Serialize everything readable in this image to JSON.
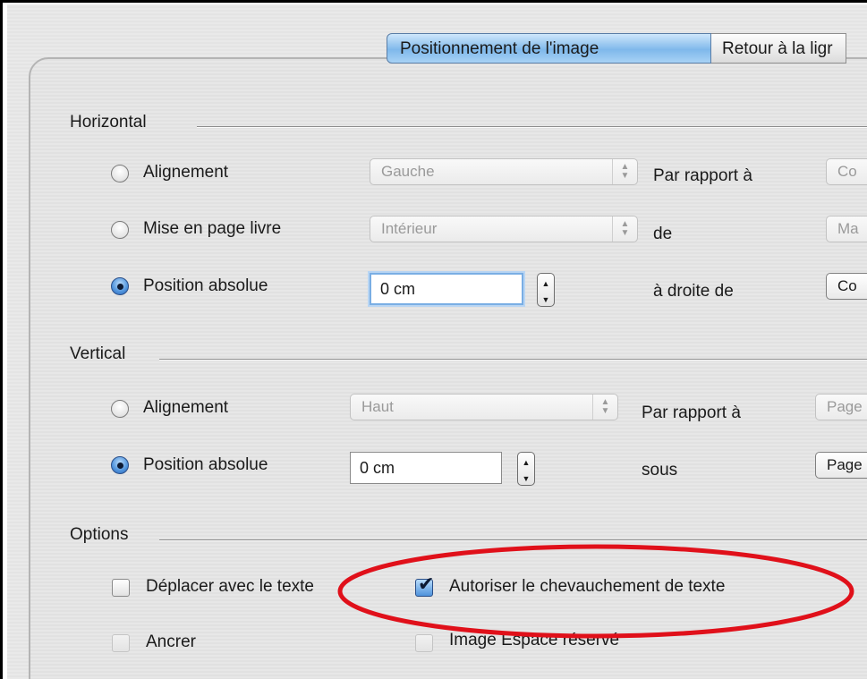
{
  "tabs": {
    "active": "Positionnement de l'image",
    "next": "Retour à la ligr"
  },
  "horizontal": {
    "title": "Horizontal",
    "alignment": {
      "label": "Alignement",
      "value": "Gauche",
      "relation": "Par rapport à",
      "relative_value": "Co",
      "selected": false
    },
    "book_layout": {
      "label": "Mise en page livre",
      "value": "Intérieur",
      "relation": "de",
      "relative_value": "Ma",
      "selected": false
    },
    "absolute": {
      "label": "Position absolue",
      "value": "0 cm",
      "relation": "à droite de",
      "relative_value": "Co",
      "selected": true
    }
  },
  "vertical": {
    "title": "Vertical",
    "alignment": {
      "label": "Alignement",
      "value": "Haut",
      "relation": "Par rapport à",
      "relative_value": "Page",
      "selected": false
    },
    "absolute": {
      "label": "Position absolue",
      "value": "0 cm",
      "relation": "sous",
      "relative_value": "Page",
      "selected": true
    }
  },
  "options": {
    "title": "Options",
    "move_with_text": {
      "label": "Déplacer avec le texte",
      "checked": false
    },
    "allow_overlap": {
      "label": "Autoriser le chevauchement de texte",
      "checked": true
    },
    "anchor": {
      "label": "Ancrer",
      "checked": false,
      "disabled": true
    },
    "placeholder": {
      "label": "Image Espace réservé",
      "checked": false,
      "disabled": true
    }
  },
  "colors": {
    "annotation": "#e0101a",
    "accent": "#4f93dc"
  }
}
